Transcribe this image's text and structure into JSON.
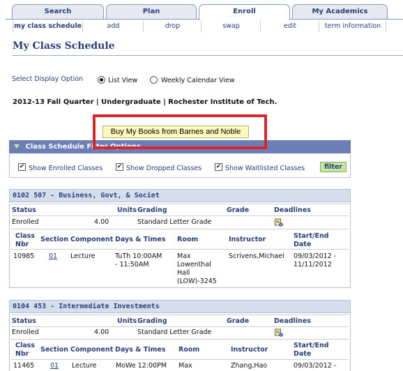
{
  "tabs": [
    {
      "label": "Search"
    },
    {
      "label": "Plan"
    },
    {
      "label": "Enroll"
    },
    {
      "label": "My Academics"
    }
  ],
  "subtabs": [
    {
      "label": "my class schedule"
    },
    {
      "label": "add"
    },
    {
      "label": "drop"
    },
    {
      "label": "swap"
    },
    {
      "label": "edit"
    },
    {
      "label": "term information"
    }
  ],
  "page_title": "My Class Schedule",
  "display_option": {
    "label": "Select Display Option",
    "list_view": "List View",
    "weekly_view": "Weekly Calendar View"
  },
  "term": "2012-13 Fall Quarter | Undergraduate | Rochester Institute of Tech.",
  "buy_books": "Buy My Books from Barnes and Noble",
  "filter": {
    "title": "Class Schedule Filter Options",
    "show_enrolled": "Show Enrolled Classes",
    "show_dropped": "Show Dropped Classes",
    "show_waitlisted": "Show Waitlisted Classes",
    "button": "filter"
  },
  "status_headers": [
    "Status",
    "Units",
    "Grading",
    "Grade",
    "Deadlines"
  ],
  "class_headers": {
    "nbr1": "Class",
    "nbr2": "Nbr",
    "section": "Section",
    "component": "Component",
    "days_times": "Days & Times",
    "room": "Room",
    "instructor": "Instructor",
    "dates1": "Start/End",
    "dates2": "Date"
  },
  "courses": [
    {
      "title": "0102 507 - Business, Govt, & Societ",
      "status": "Enrolled",
      "units": "4.00",
      "grading": "Standard Letter Grade",
      "grade": "",
      "class_nbr": "10985",
      "section": "01",
      "component": "Lecture",
      "days_times": [
        "TuTh 10:00AM",
        "- 11:50AM"
      ],
      "room": [
        "Max",
        "Lowenthal",
        "Hall",
        "(LOW)-3245"
      ],
      "instructor": "Scrivens,Michael",
      "dates": [
        "09/03/2012 -",
        "11/11/2012"
      ]
    },
    {
      "title": "0104 453 - Intermediate Investments",
      "status": "Enrolled",
      "units": "4.00",
      "grading": "Standard Letter Grade",
      "grade": "",
      "class_nbr": "11465",
      "section": "01",
      "component": "Lecture",
      "days_times": [
        "MoWe 12:00PM"
      ],
      "room": [
        "Max"
      ],
      "instructor": "Zhang,Hao",
      "dates": [
        "09/03/2012 -"
      ]
    }
  ],
  "colors": {
    "brand_blue": "#2a3e7a",
    "header_bar": "#6b7fb4",
    "course_head": "#d5deed",
    "highlight_red": "#d9262b",
    "book_button": "#fbf9bc",
    "filter_button": "#c6e7a0"
  }
}
